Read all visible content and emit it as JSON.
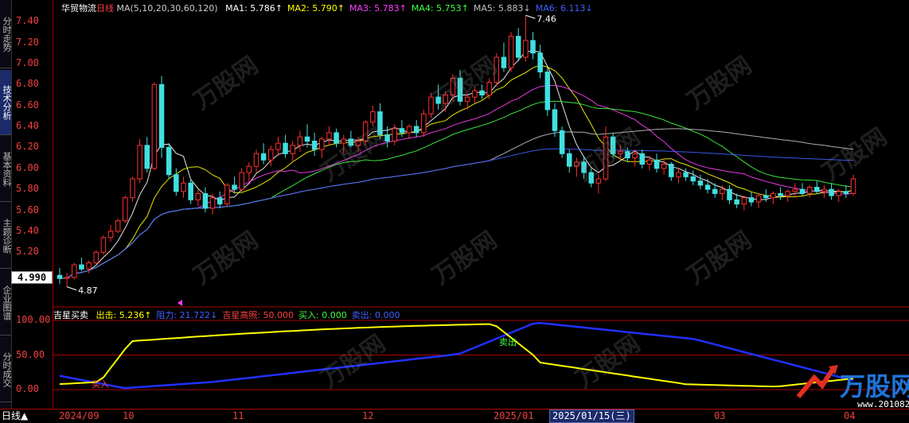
{
  "sidebar": {
    "tabs": [
      {
        "label": "分时走势",
        "active": false
      },
      {
        "label": "技术分析",
        "active": true
      },
      {
        "label": "基本资料",
        "active": false
      },
      {
        "label": "主题诊断",
        "active": false
      },
      {
        "label": "企业图谱",
        "active": false
      },
      {
        "label": "分时成交",
        "active": false
      },
      {
        "label": "基",
        "active": false
      }
    ]
  },
  "header": {
    "stock_name": "华贸物流",
    "period": "日线",
    "ma_params": "MA(5,10,20,30,60,120)",
    "ma": [
      {
        "label": "MA1:",
        "value": "5.786",
        "arrow": "↑",
        "color": "#ffffff"
      },
      {
        "label": "MA2:",
        "value": "5.790",
        "arrow": "↑",
        "color": "#ffff00"
      },
      {
        "label": "MA3:",
        "value": "5.783",
        "arrow": "↑",
        "color": "#ff40ff"
      },
      {
        "label": "MA4:",
        "value": "5.753",
        "arrow": "↑",
        "color": "#40ff40"
      },
      {
        "label": "MA5:",
        "value": "5.883",
        "arrow": "↓",
        "color": "#c0c0c0"
      },
      {
        "label": "MA6:",
        "value": "6.113",
        "arrow": "↓",
        "color": "#4060ff"
      }
    ]
  },
  "price_axis": [
    "7.40",
    "7.20",
    "7.00",
    "6.80",
    "6.60",
    "6.40",
    "6.20",
    "6.00",
    "5.80",
    "5.60",
    "5.40",
    "5.20"
  ],
  "current_price": "4.990",
  "annotations": {
    "high": "7.46",
    "low": "4.87"
  },
  "indicator": {
    "name": "吉星买卖",
    "items": [
      {
        "label": "出击:",
        "value": "5.236",
        "arrow": "↑",
        "color": "#ffff00"
      },
      {
        "label": "阻力:",
        "value": "21.722",
        "arrow": "↓",
        "color": "#4060ff"
      },
      {
        "label": "吉星高照:",
        "value": "50.000",
        "arrow": "",
        "color": "#ff4040"
      },
      {
        "label": "买入:",
        "value": "0.000",
        "arrow": "",
        "color": "#40ff40"
      },
      {
        "label": "卖出:",
        "value": "0.000",
        "arrow": "",
        "color": "#4060ff"
      }
    ],
    "axis": [
      "100.00",
      "50.00",
      "0.00"
    ],
    "signals": {
      "buy": "买入",
      "sell": "卖出"
    }
  },
  "x_axis": [
    "2024/09",
    "10",
    "11",
    "12",
    "2025/01",
    "03",
    "04"
  ],
  "selected_date": "2025/01/15(三)",
  "bottom": {
    "period_button": "日线"
  },
  "watermark": {
    "brand": "万股网",
    "url": "www.201082.com"
  },
  "chart_data": {
    "type": "candlestick",
    "ylim": [
      4.8,
      7.5
    ],
    "candles": [
      [
        4.98,
        5.05,
        4.9,
        4.95
      ],
      [
        4.95,
        5.0,
        4.87,
        4.96
      ],
      [
        4.96,
        5.1,
        4.94,
        5.08
      ],
      [
        5.08,
        5.15,
        5.02,
        5.04
      ],
      [
        5.04,
        5.12,
        5.0,
        5.1
      ],
      [
        5.1,
        5.22,
        5.08,
        5.2
      ],
      [
        5.2,
        5.36,
        5.18,
        5.34
      ],
      [
        5.34,
        5.46,
        5.3,
        5.4
      ],
      [
        5.4,
        5.52,
        5.38,
        5.5
      ],
      [
        5.5,
        5.74,
        5.48,
        5.72
      ],
      [
        5.72,
        5.92,
        5.68,
        5.9
      ],
      [
        5.9,
        6.28,
        5.86,
        6.22
      ],
      [
        6.22,
        6.3,
        5.96,
        6.0
      ],
      [
        6.0,
        6.82,
        5.98,
        6.8
      ],
      [
        6.8,
        6.88,
        6.1,
        6.2
      ],
      [
        6.2,
        6.24,
        5.9,
        5.94
      ],
      [
        5.94,
        6.0,
        5.74,
        5.78
      ],
      [
        5.78,
        5.92,
        5.72,
        5.86
      ],
      [
        5.86,
        5.9,
        5.66,
        5.7
      ],
      [
        5.7,
        5.8,
        5.64,
        5.76
      ],
      [
        5.76,
        5.82,
        5.58,
        5.62
      ],
      [
        5.62,
        5.76,
        5.56,
        5.72
      ],
      [
        5.72,
        5.78,
        5.62,
        5.66
      ],
      [
        5.66,
        5.86,
        5.64,
        5.84
      ],
      [
        5.84,
        5.92,
        5.76,
        5.8
      ],
      [
        5.8,
        6.0,
        5.78,
        5.96
      ],
      [
        5.96,
        6.06,
        5.88,
        6.02
      ],
      [
        6.02,
        6.18,
        5.96,
        6.14
      ],
      [
        6.14,
        6.24,
        6.04,
        6.08
      ],
      [
        6.08,
        6.22,
        6.02,
        6.18
      ],
      [
        6.18,
        6.3,
        6.12,
        6.24
      ],
      [
        6.24,
        6.32,
        6.1,
        6.14
      ],
      [
        6.14,
        6.26,
        6.06,
        6.22
      ],
      [
        6.22,
        6.36,
        6.16,
        6.3
      ],
      [
        6.3,
        6.42,
        6.2,
        6.26
      ],
      [
        6.26,
        6.34,
        6.12,
        6.18
      ],
      [
        6.18,
        6.3,
        6.1,
        6.28
      ],
      [
        6.28,
        6.4,
        6.22,
        6.34
      ],
      [
        6.34,
        6.38,
        6.2,
        6.24
      ],
      [
        6.24,
        6.32,
        6.14,
        6.28
      ],
      [
        6.28,
        6.36,
        6.2,
        6.22
      ],
      [
        6.22,
        6.3,
        6.16,
        6.26
      ],
      [
        6.26,
        6.46,
        6.22,
        6.44
      ],
      [
        6.44,
        6.6,
        6.4,
        6.54
      ],
      [
        6.54,
        6.62,
        6.28,
        6.32
      ],
      [
        6.32,
        6.4,
        6.2,
        6.26
      ],
      [
        6.26,
        6.42,
        6.22,
        6.38
      ],
      [
        6.38,
        6.46,
        6.3,
        6.34
      ],
      [
        6.34,
        6.42,
        6.28,
        6.4
      ],
      [
        6.4,
        6.46,
        6.3,
        6.34
      ],
      [
        6.34,
        6.56,
        6.3,
        6.52
      ],
      [
        6.52,
        6.72,
        6.48,
        6.68
      ],
      [
        6.68,
        6.8,
        6.56,
        6.62
      ],
      [
        6.62,
        6.74,
        6.54,
        6.7
      ],
      [
        6.7,
        6.9,
        6.64,
        6.86
      ],
      [
        6.86,
        6.94,
        6.6,
        6.64
      ],
      [
        6.64,
        6.72,
        6.56,
        6.68
      ],
      [
        6.68,
        6.78,
        6.62,
        6.74
      ],
      [
        6.74,
        6.8,
        6.66,
        6.7
      ],
      [
        6.7,
        6.86,
        6.66,
        6.82
      ],
      [
        6.82,
        7.1,
        6.78,
        7.06
      ],
      [
        7.06,
        7.2,
        6.92,
        6.96
      ],
      [
        6.96,
        7.3,
        6.92,
        7.26
      ],
      [
        7.26,
        7.34,
        7.02,
        7.06
      ],
      [
        7.06,
        7.46,
        7.02,
        7.22
      ],
      [
        7.22,
        7.3,
        7.04,
        7.1
      ],
      [
        7.1,
        7.18,
        6.86,
        6.92
      ],
      [
        6.92,
        6.96,
        6.5,
        6.56
      ],
      [
        6.56,
        6.62,
        6.3,
        6.36
      ],
      [
        6.36,
        6.4,
        6.1,
        6.14
      ],
      [
        6.14,
        6.18,
        5.96,
        6.02
      ],
      [
        6.02,
        6.1,
        5.92,
        6.06
      ],
      [
        6.06,
        6.12,
        5.9,
        5.96
      ],
      [
        5.96,
        6.0,
        5.82,
        5.86
      ],
      [
        5.86,
        5.94,
        5.76,
        5.9
      ],
      [
        5.9,
        6.4,
        5.88,
        6.3
      ],
      [
        6.3,
        6.34,
        6.1,
        6.14
      ],
      [
        6.14,
        6.22,
        6.08,
        6.16
      ],
      [
        6.16,
        6.2,
        6.06,
        6.1
      ],
      [
        6.1,
        6.18,
        6.02,
        6.14
      ],
      [
        6.14,
        6.18,
        6.0,
        6.04
      ],
      [
        6.04,
        6.12,
        5.98,
        6.08
      ],
      [
        6.08,
        6.14,
        5.96,
        6.0
      ],
      [
        6.0,
        6.08,
        5.94,
        6.04
      ],
      [
        6.04,
        6.06,
        5.88,
        5.92
      ],
      [
        5.92,
        6.0,
        5.86,
        5.96
      ],
      [
        5.96,
        6.0,
        5.88,
        5.92
      ],
      [
        5.92,
        5.98,
        5.84,
        5.88
      ],
      [
        5.88,
        5.94,
        5.8,
        5.84
      ],
      [
        5.84,
        5.9,
        5.76,
        5.8
      ],
      [
        5.8,
        5.86,
        5.72,
        5.76
      ],
      [
        5.76,
        5.84,
        5.7,
        5.8
      ],
      [
        5.8,
        5.84,
        5.66,
        5.7
      ],
      [
        5.7,
        5.76,
        5.62,
        5.66
      ],
      [
        5.66,
        5.74,
        5.6,
        5.72
      ],
      [
        5.72,
        5.78,
        5.64,
        5.68
      ],
      [
        5.68,
        5.76,
        5.62,
        5.74
      ],
      [
        5.74,
        5.8,
        5.68,
        5.72
      ],
      [
        5.72,
        5.78,
        5.66,
        5.76
      ],
      [
        5.76,
        5.82,
        5.7,
        5.74
      ],
      [
        5.74,
        5.8,
        5.68,
        5.78
      ],
      [
        5.78,
        5.86,
        5.72,
        5.8
      ],
      [
        5.8,
        5.86,
        5.74,
        5.76
      ],
      [
        5.76,
        5.84,
        5.72,
        5.82
      ],
      [
        5.82,
        5.88,
        5.76,
        5.78
      ],
      [
        5.78,
        5.84,
        5.72,
        5.8
      ],
      [
        5.8,
        5.86,
        5.7,
        5.74
      ],
      [
        5.74,
        5.8,
        5.68,
        5.78
      ],
      [
        5.78,
        5.84,
        5.72,
        5.76
      ],
      [
        5.76,
        5.94,
        5.74,
        5.9
      ]
    ]
  }
}
